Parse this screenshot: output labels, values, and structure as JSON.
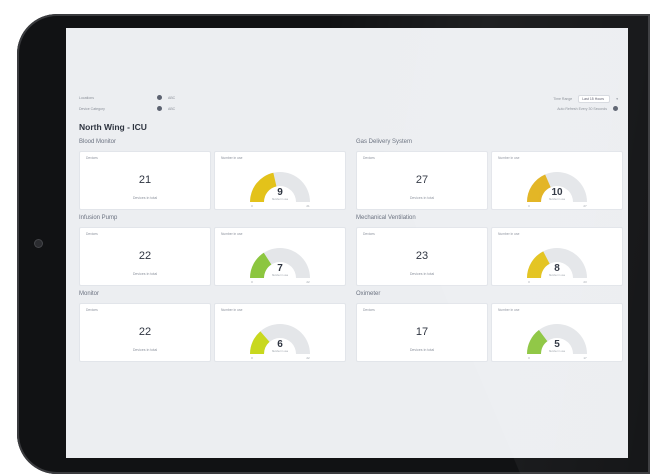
{
  "colors": {
    "green": "#8cc63f",
    "lime": "#c8d81e",
    "yellow": "#e3c21a",
    "gold": "#e2b21c",
    "track": "#e4e6e9",
    "screen_bg": "#eceef1"
  },
  "filters": {
    "left": [
      {
        "label": "Locations",
        "value": "ABC"
      },
      {
        "label": "Device Category",
        "value": "ABC"
      }
    ],
    "right": [
      {
        "label": "Time Range",
        "value": "Last 15 Hours"
      },
      {
        "label": "Auto Refresh Every 30 Seconds"
      }
    ]
  },
  "ward": {
    "title": "North Wing - ICU"
  },
  "sections": [
    {
      "name": "Blood Monitor",
      "devices_label": "Devices",
      "total": "21",
      "total_label": "Devices in total",
      "gauge_label": "Number in use",
      "in_use": 9,
      "min": "0",
      "max": "21",
      "color_key": "yellow"
    },
    {
      "name": "Gas Delivery System",
      "devices_label": "Devices",
      "total": "27",
      "total_label": "Devices in total",
      "gauge_label": "Number in use",
      "in_use": 10,
      "min": "0",
      "max": "27",
      "color_key": "gold"
    },
    {
      "name": "Infusion Pump",
      "devices_label": "Devices",
      "total": "22",
      "total_label": "Devices in total",
      "gauge_label": "Number in use",
      "in_use": 7,
      "min": "0",
      "max": "22",
      "color_key": "green"
    },
    {
      "name": "Mechanical Ventilation",
      "devices_label": "Devices",
      "total": "23",
      "total_label": "Devices in total",
      "gauge_label": "Number in use",
      "in_use": 8,
      "min": "0",
      "max": "23",
      "color_key": "yellow"
    },
    {
      "name": "Monitor",
      "devices_label": "Devices",
      "total": "22",
      "total_label": "Devices in total",
      "gauge_label": "Number in use",
      "in_use": 6,
      "min": "0",
      "max": "22",
      "color_key": "lime"
    },
    {
      "name": "Oximeter",
      "devices_label": "Devices",
      "total": "17",
      "total_label": "Devices in total",
      "gauge_label": "Number in use",
      "in_use": 5,
      "min": "0",
      "max": "17",
      "color_key": "green"
    }
  ]
}
